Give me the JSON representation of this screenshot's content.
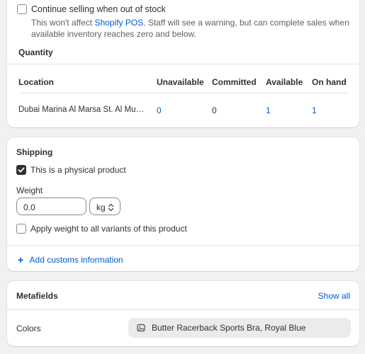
{
  "inventory": {
    "continue_selling_label": "Continue selling when out of stock",
    "continue_selling_checked": false,
    "help_prefix": "This won't affect ",
    "help_link": "Shopify POS",
    "help_suffix_line1": ". Staff will see a warning, but can complete sales when",
    "help_line2": "available inventory reaches zero and below.",
    "quantity_heading": "Quantity",
    "table": {
      "headers": [
        "Location",
        "Unavailable",
        "Committed",
        "Available",
        "On hand"
      ],
      "rows": [
        {
          "location": "Dubai Marina Al Marsa St. Al Mu…",
          "unavailable": "0",
          "committed": "0",
          "available": "1",
          "on_hand": "1"
        }
      ]
    }
  },
  "shipping": {
    "heading": "Shipping",
    "physical_label": "This is a physical product",
    "physical_checked": true,
    "weight_label": "Weight",
    "weight_value": "0.0",
    "unit_value": "kg",
    "apply_all_label": "Apply weight to all variants of this product",
    "apply_all_checked": false,
    "add_customs_label": "Add customs information"
  },
  "metafields": {
    "heading": "Metafields",
    "show_all_label": "Show all",
    "rows": [
      {
        "label": "Colors",
        "value": "Butter Racerback Sports Bra, Royal Blue"
      }
    ]
  },
  "colors": {
    "link": "#005bd3",
    "text": "#303030",
    "background": "#f1f1f1"
  }
}
